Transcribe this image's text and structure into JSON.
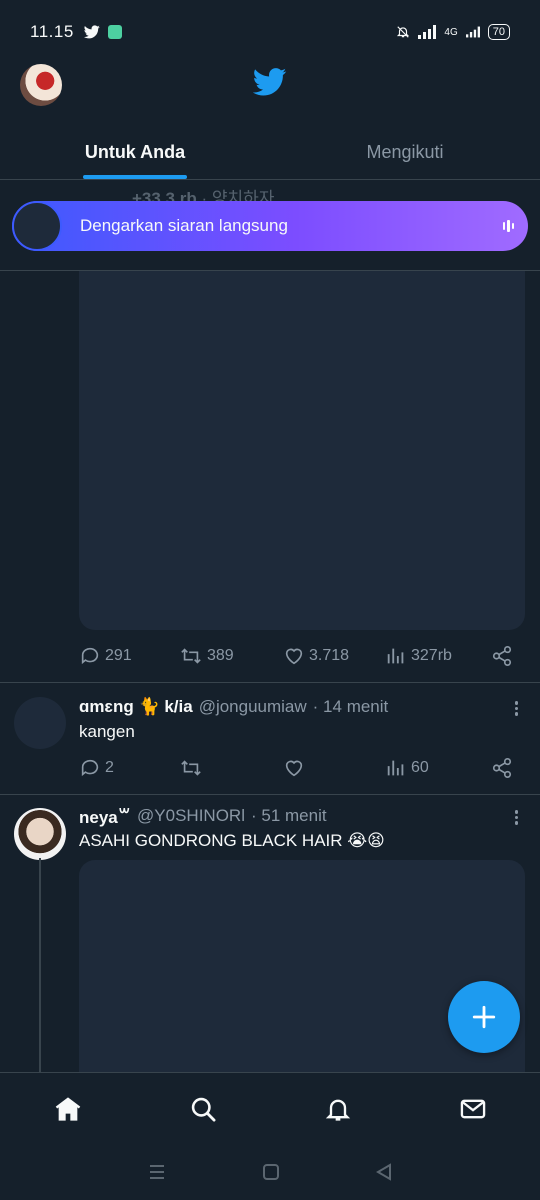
{
  "status": {
    "time": "11.15",
    "network": "4G",
    "battery": "70"
  },
  "tabs": [
    {
      "label": "Untuk Anda",
      "active": true
    },
    {
      "label": "Mengikuti",
      "active": false
    }
  ],
  "ghost": {
    "count": "+33,3 rb",
    "sep": "·",
    "name": "양치하자"
  },
  "live_banner": {
    "text": "Dengarkan siaran langsung"
  },
  "post1": {
    "replies": "291",
    "retweets": "389",
    "likes": "3.718",
    "views": "327rb"
  },
  "post2": {
    "name": "ɑmɛng 🐈 k/ia",
    "handle": "@jonguumiaw",
    "time": "· 14 menit",
    "text": "kangen",
    "replies": "2",
    "retweets": "",
    "likes": "",
    "views": "60"
  },
  "post3": {
    "name": "neya꒳",
    "handle": "@Y0SHINORl",
    "time": "· 51 menit",
    "text": "ASAHI GONDRONG BLACK HAIR 😭😫"
  },
  "colors": {
    "accent": "#1d9bf0",
    "bg": "#15202b",
    "muted": "#8b98a5"
  }
}
